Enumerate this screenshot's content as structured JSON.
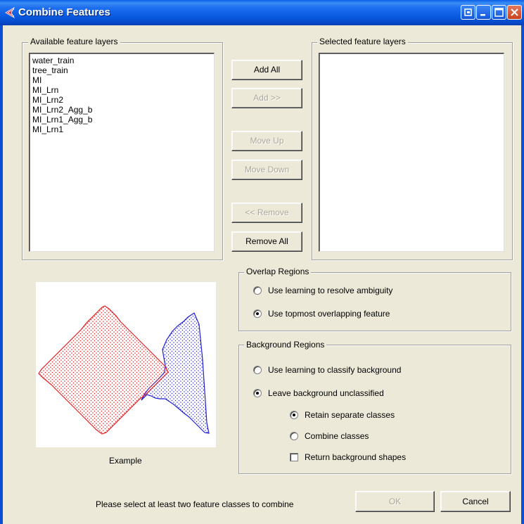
{
  "window": {
    "title": "Combine Features",
    "title_bar_buttons": [
      "restore-icon",
      "minimize-icon",
      "maximize-icon",
      "close-icon"
    ]
  },
  "available_layers": {
    "legend": "Available feature layers",
    "items": [
      "water_train",
      "tree_train",
      "MI",
      "MI_Lrn",
      "MI_Lrn2",
      "MI_Lrn2_Agg_b",
      "MI_Lrn1_Agg_b",
      "MI_Lrn1"
    ]
  },
  "selected_layers": {
    "legend": "Selected feature layers",
    "items": []
  },
  "buttons": {
    "add_all": "Add All",
    "add": "Add >>",
    "move_up": "Move Up",
    "move_down": "Move Down",
    "remove": "<< Remove",
    "remove_all": "Remove All",
    "ok": "OK",
    "cancel": "Cancel"
  },
  "overlap_regions": {
    "legend": "Overlap Regions",
    "options": [
      {
        "label": "Use learning to resolve ambiguity",
        "selected": false
      },
      {
        "label": "Use topmost overlapping feature",
        "selected": true
      }
    ]
  },
  "background_regions": {
    "legend": "Background Regions",
    "options": [
      {
        "label": "Use learning to classify background",
        "selected": false
      },
      {
        "label": "Leave background unclassified",
        "selected": true
      }
    ],
    "sub_options": [
      {
        "label": "Retain separate classes",
        "selected": true
      },
      {
        "label": "Combine classes",
        "selected": false
      }
    ],
    "checkbox": {
      "label": "Return background shapes",
      "checked": false
    }
  },
  "example": {
    "caption": "Example",
    "colors": {
      "red": "#E02020",
      "blue": "#2020D0"
    }
  },
  "status_message": "Please select at least two feature classes to combine"
}
